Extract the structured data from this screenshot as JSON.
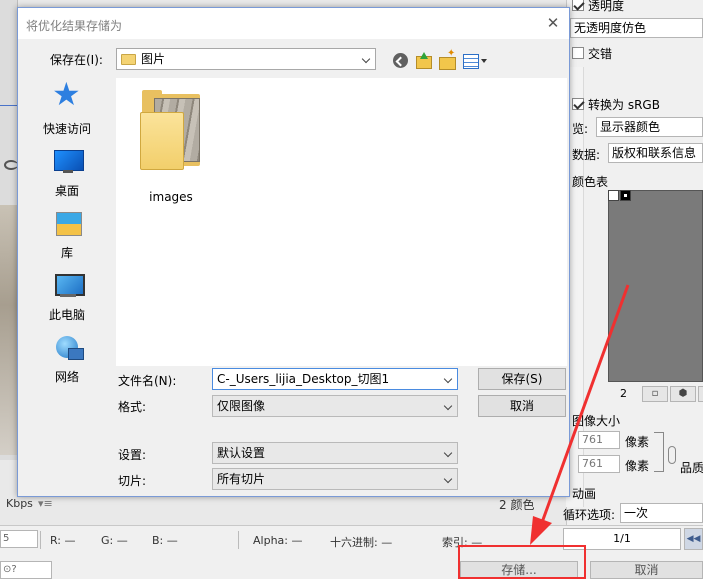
{
  "background": {
    "right_panel": {
      "transparency_label": "透明度",
      "no_transparency_dither": "无透明度仿色",
      "interlaced_label": "交错",
      "convert_srgb_label": "转换为 sRGB",
      "preview_label": "览:",
      "preview_value": "显示器颜色",
      "metadata_label": "数据:",
      "metadata_value": "版权和联系信息",
      "color_table_label": "颜色表",
      "color_count": "2",
      "image_size_label": "图像大小",
      "width_value": "761",
      "height_value": "761",
      "pixels_label_1": "像素",
      "pixels_label_2": "像素",
      "quality_label": "品质",
      "animation_label": "动画",
      "loop_label": "循环选项:",
      "loop_value": "一次",
      "pager_value": "1/1"
    },
    "status": {
      "kbps_label": "Kbps",
      "colors_count": "2 颜色",
      "zoom_value": "5",
      "r_label": "R: —",
      "g_label": "G: —",
      "b_label": "B: —",
      "alpha_label": "Alpha: —",
      "hex_label": "十六进制: —",
      "index_label": "索引: —",
      "save_label": "存储...",
      "cancel_label": "取消"
    }
  },
  "dialog": {
    "title": "将优化结果存储为",
    "save_in_label": "保存在(I):",
    "save_in_value": "图片",
    "places": [
      {
        "label": "快速访问",
        "icon": "quick-access-icon"
      },
      {
        "label": "桌面",
        "icon": "desktop-icon"
      },
      {
        "label": "库",
        "icon": "library-icon"
      },
      {
        "label": "此电脑",
        "icon": "this-pc-icon"
      },
      {
        "label": "网络",
        "icon": "network-icon"
      }
    ],
    "files": [
      {
        "name": "images",
        "type": "folder"
      }
    ],
    "filename_label": "文件名(N):",
    "filename_value": "C-_Users_lijia_Desktop_切图1",
    "format_label": "格式:",
    "format_value": "仅限图像",
    "settings_label": "设置:",
    "settings_value": "默认设置",
    "slices_label": "切片:",
    "slices_value": "所有切片",
    "save_button": "保存(S)",
    "cancel_button": "取消"
  },
  "colors": {
    "accent_border": "#7a9ad6",
    "annotation_red": "#f03030"
  }
}
